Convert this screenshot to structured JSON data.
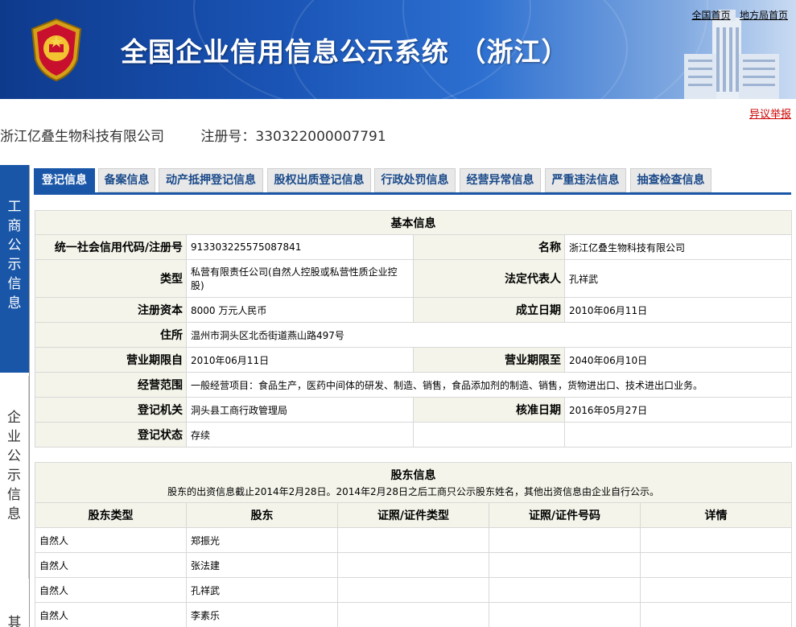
{
  "header": {
    "site_title": "全国企业信用信息公示系统 （浙江）",
    "links": [
      "全国首页",
      "地方局首页"
    ],
    "objection": "异议举报"
  },
  "company": {
    "name": "浙江亿叠生物科技有限公司",
    "reg_label": "注册号：",
    "reg_no": "330322000007791"
  },
  "leftnav": {
    "gs": "工商公示信息",
    "qy": "企业公示信息",
    "qi": "其"
  },
  "tabs": [
    "登记信息",
    "备案信息",
    "动产抵押登记信息",
    "股权出质登记信息",
    "行政处罚信息",
    "经营异常信息",
    "严重违法信息",
    "抽查检查信息"
  ],
  "active_tab": "登记信息",
  "basic": {
    "title": "基本信息",
    "credit_code_label": "统一社会信用代码/注册号",
    "credit_code": "913303225575087841",
    "name_label": "名称",
    "name": "浙江亿叠生物科技有限公司",
    "type_label": "类型",
    "type": "私营有限责任公司(自然人控股或私营性质企业控股)",
    "legal_rep_label": "法定代表人",
    "legal_rep": "孔祥武",
    "capital_label": "注册资本",
    "capital": "8000 万元人民币",
    "est_date_label": "成立日期",
    "est_date": "2010年06月11日",
    "address_label": "住所",
    "address": "温州市洞头区北岙街道燕山路497号",
    "period_from_label": "营业期限自",
    "period_from": "2010年06月11日",
    "period_to_label": "营业期限至",
    "period_to": "2040年06月10日",
    "scope_label": "经营范围",
    "scope": "一般经营项目：食品生产，医药中间体的研发、制造、销售，食品添加剂的制造、销售，货物进出口、技术进出口业务。",
    "authority_label": "登记机关",
    "authority": "洞头县工商行政管理局",
    "approval_date_label": "核准日期",
    "approval_date": "2016年05月27日",
    "status_label": "登记状态",
    "status": "存续"
  },
  "shareholders": {
    "title": "股东信息",
    "note": "股东的出资信息截止2014年2月28日。2014年2月28日之后工商只公示股东姓名，其他出资信息由企业自行公示。",
    "columns": [
      "股东类型",
      "股东",
      "证照/证件类型",
      "证照/证件号码",
      "详情"
    ],
    "rows": [
      {
        "type": "自然人",
        "name": "郑振光",
        "id_type": "",
        "id_no": "",
        "detail": ""
      },
      {
        "type": "自然人",
        "name": "张法建",
        "id_type": "",
        "id_no": "",
        "detail": ""
      },
      {
        "type": "自然人",
        "name": "孔祥武",
        "id_type": "",
        "id_no": "",
        "detail": ""
      },
      {
        "type": "自然人",
        "name": "李素乐",
        "id_type": "",
        "id_no": "",
        "detail": ""
      }
    ]
  },
  "colors": {
    "primary_blue": "#1a56a8",
    "label_bg": "#f4f4ea",
    "link_red": "#cc0000"
  }
}
